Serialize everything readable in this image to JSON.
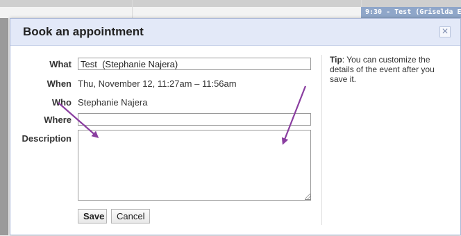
{
  "background": {
    "event_label": "9:30 - Test (Griselda Esparza"
  },
  "dialog": {
    "title": "Book an appointment",
    "close_icon": "close-icon"
  },
  "form": {
    "what_label": "What",
    "what_value": "Test  (Stephanie Najera)",
    "when_label": "When",
    "when_value": "Thu, November 12, 11:27am – 11:56am",
    "who_label": "Who",
    "who_value": "Stephanie Najera",
    "where_label": "Where",
    "where_value": "",
    "description_label": "Description",
    "description_value": "",
    "save_label": "Save",
    "cancel_label": "Cancel"
  },
  "tip": {
    "prefix": "Tip",
    "text": ": You can customize the details of the event after you save it."
  },
  "colors": {
    "arrow": "#8a3ea0",
    "header_bg": "#e3e9f8"
  }
}
